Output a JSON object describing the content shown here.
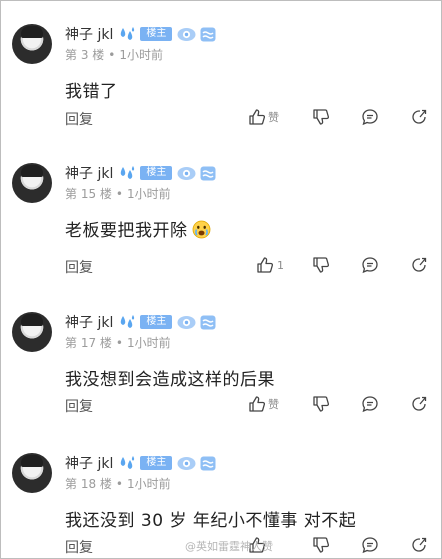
{
  "comments": [
    {
      "username": "神子 jkl",
      "badge": "楼主",
      "floor": "第 3 楼",
      "time": "1小时前",
      "content": "我错了",
      "reply_label": "回复",
      "like_label": "赞"
    },
    {
      "username": "神子 jkl",
      "badge": "楼主",
      "floor": "第 15 楼",
      "time": "1小时前",
      "content": "老板要把我开除",
      "reply_label": "回复",
      "like_label": "1"
    },
    {
      "username": "神子 jkl",
      "badge": "楼主",
      "floor": "第 17 楼",
      "time": "1小时前",
      "content": "我没想到会造成这样的后果",
      "reply_label": "回复",
      "like_label": "赞"
    },
    {
      "username": "神子 jkl",
      "badge": "楼主",
      "floor": "第 18 楼",
      "time": "1小时前",
      "content": "我还没到 30 岁 年纪小不懂事 对不起",
      "reply_label": "回复",
      "like_label": ""
    }
  ],
  "meta_separator": "•",
  "watermark": "@英如雷霆神人赞",
  "icons": {
    "drop": "water-drops-icon",
    "level": "level-eye-icon",
    "wave": "wave-badge-icon",
    "like": "thumbs-up-icon",
    "dislike": "thumbs-down-icon",
    "comment": "comment-icon",
    "share": "share-icon",
    "emoji": "crying-face-icon"
  },
  "colors": {
    "badge": "#7ab2f3",
    "drop": "#5aa6f0",
    "text": "#222222",
    "meta": "#9b9b9b"
  }
}
